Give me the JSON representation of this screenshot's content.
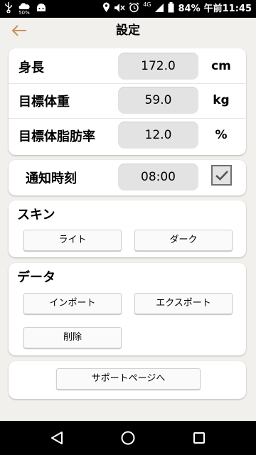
{
  "status_bar": {
    "small_battery_pct": "50%",
    "network": "4G",
    "battery": "84%",
    "time": "午前11:45"
  },
  "header": {
    "title": "設定"
  },
  "profile": {
    "height": {
      "label": "身長",
      "value": "172.0",
      "unit": "cm"
    },
    "target_weight": {
      "label": "目標体重",
      "value": "59.0",
      "unit": "kg"
    },
    "target_body_fat": {
      "label": "目標体脂肪率",
      "value": "12.0",
      "unit": "%"
    }
  },
  "notification": {
    "label": "通知時刻",
    "value": "08:00",
    "enabled": true
  },
  "skin": {
    "title": "スキン",
    "light_label": "ライト",
    "dark_label": "ダーク"
  },
  "data_section": {
    "title": "データ",
    "import_label": "インポート",
    "export_label": "エクスポート",
    "delete_label": "削除"
  },
  "support": {
    "label": "サポートページへ"
  },
  "colors": {
    "accent_back_arrow": "#c8915a",
    "checkmark": "#555555"
  }
}
